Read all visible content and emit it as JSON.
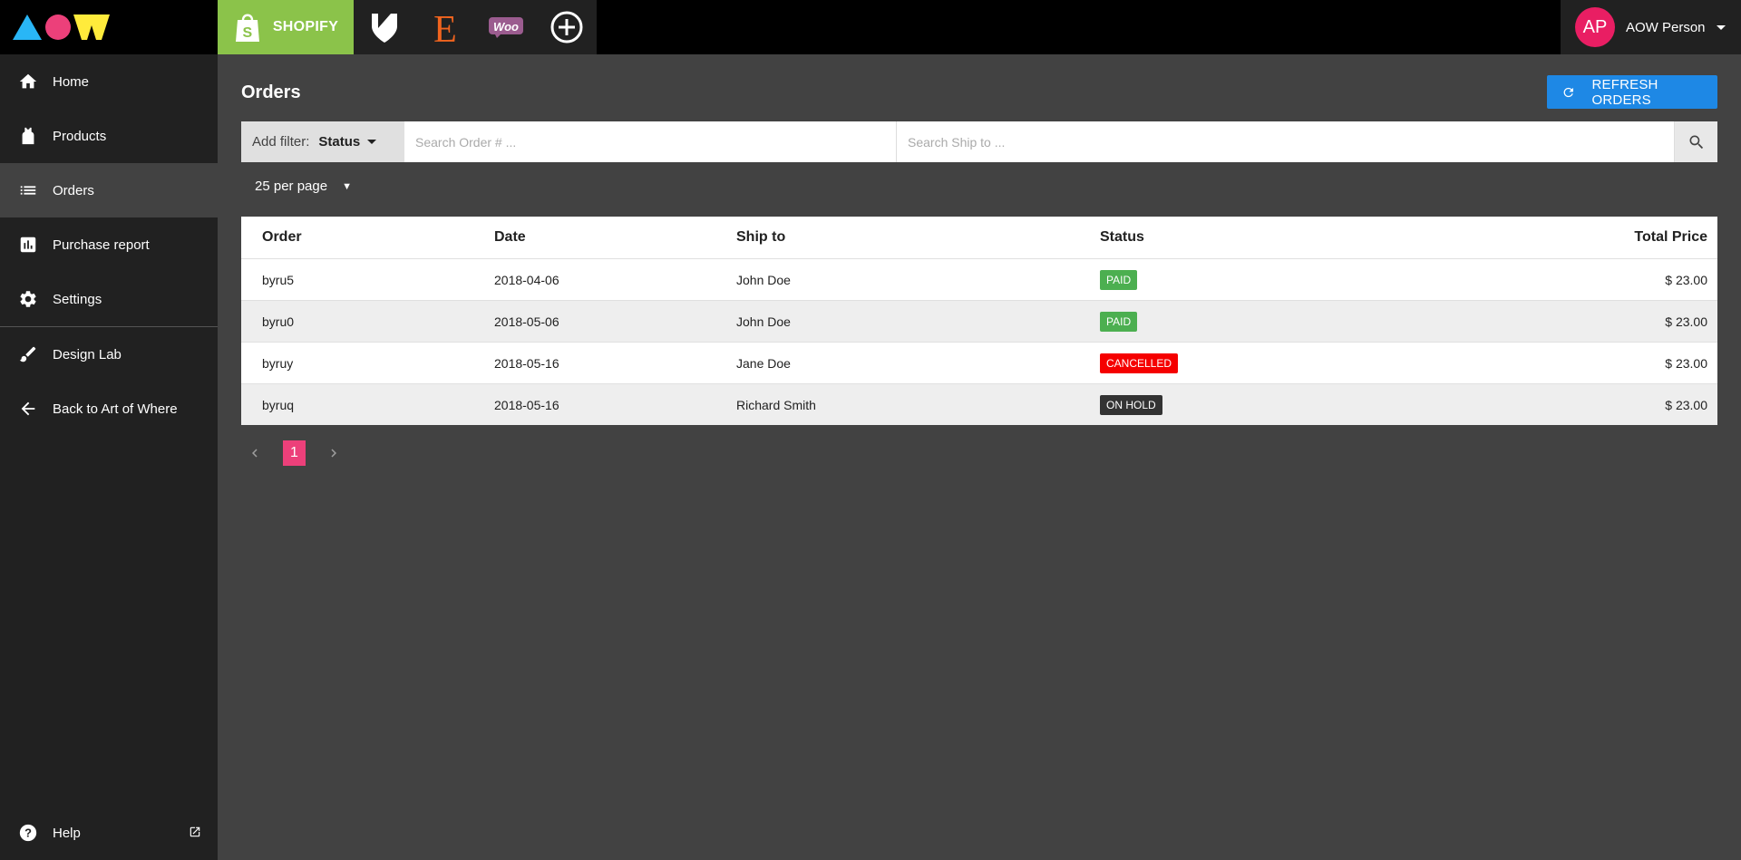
{
  "topbar": {
    "platform_tabs": [
      "SHOPIFY"
    ],
    "user": {
      "initials": "AP",
      "name": "AOW Person"
    }
  },
  "sidebar": {
    "items": [
      {
        "label": "Home",
        "icon": "home-icon"
      },
      {
        "label": "Products",
        "icon": "product-icon"
      },
      {
        "label": "Orders",
        "icon": "list-icon",
        "active": true
      },
      {
        "label": "Purchase report",
        "icon": "bar-chart-icon"
      },
      {
        "label": "Settings",
        "icon": "gear-icon"
      },
      {
        "label": "Design Lab",
        "icon": "brush-icon"
      },
      {
        "label": "Back to Art of Where",
        "icon": "arrow-left-icon"
      }
    ],
    "help_label": "Help"
  },
  "main": {
    "title": "Orders",
    "refresh_label": "REFRESH ORDERS",
    "filter": {
      "add_filter_label": "Add filter:",
      "status_label": "Status",
      "order_placeholder": "Search Order # ...",
      "ship_placeholder": "Search Ship to ..."
    },
    "per_page": "25 per page",
    "table": {
      "headers": [
        "Order",
        "Date",
        "Ship to",
        "Status",
        "Total Price"
      ],
      "rows": [
        {
          "order": "byru5",
          "date": "2018-04-06",
          "ship_to": "John Doe",
          "status": "PAID",
          "total": "$ 23.00"
        },
        {
          "order": "byru0",
          "date": "2018-05-06",
          "ship_to": "John Doe",
          "status": "PAID",
          "total": "$ 23.00"
        },
        {
          "order": "byruy",
          "date": "2018-05-16",
          "ship_to": "Jane Doe",
          "status": "CANCELLED",
          "total": "$ 23.00"
        },
        {
          "order": "byruq",
          "date": "2018-05-16",
          "ship_to": "Richard Smith",
          "status": "ON HOLD",
          "total": "$ 23.00"
        }
      ]
    },
    "pagination": {
      "current_page": "1"
    }
  },
  "colors": {
    "shopify_green": "#8bc34a",
    "accent_blue": "#1e88e5",
    "pink": "#e91e63",
    "status_paid": "#4caf50",
    "status_cancelled": "#f50000",
    "status_on_hold": "#333333"
  }
}
